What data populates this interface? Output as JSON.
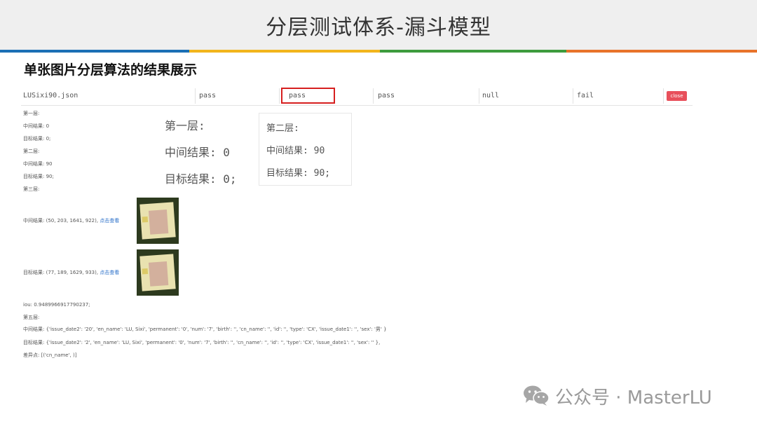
{
  "header": {
    "title": "分层测试体系-漏斗模型"
  },
  "section_title": "单张图片分层算法的结果展示",
  "result_row": {
    "file": "LUSixi90.json",
    "c1": "pass",
    "c2": "pass",
    "c3": "pass",
    "c4": "null",
    "c5": "fail",
    "close_label": "close"
  },
  "small_log": {
    "l1_title": "第一层:",
    "l1_mid": "中间结果: 0",
    "l1_target": "目标结果: 0;",
    "l2_title": "第二层:",
    "l2_mid": "中间结果: 90",
    "l2_target": "目标结果: 90;",
    "l3_title": "第三层:",
    "l3_mid": "中间结果: (50, 203, 1641, 922),",
    "l3_target": "目标结果: (77, 189, 1629, 933),",
    "view_link": "点击查看",
    "iou": "iou: 0.9489966917790237;",
    "l5_title": "第五层:",
    "l5_mid": "中间结果: {'issue_date2': '20',  'en_name': 'LU, Sixi',  'permanent': '0',  'num': '7',  'birth': '',  'cn_name': '',  'id': '',  'type': 'CX',  'issue_date1': '',  'sex': '男' }",
    "l5_target": "目标结果: {'issue_date2': '2',  'en_name': 'LU, Sixi',  'permanent': '0',  'num': '7',  'birth': '',  'cn_name': '',  'id': '',  'type': 'CX',  'issue_date1': '',  'sex': '' },",
    "diff": "差异点: [('cn_name',                 )]"
  },
  "zoom_layer1": {
    "title": "第一层:",
    "mid": "中间结果: 0",
    "target": "目标结果: 0;"
  },
  "zoom_layer2": {
    "title": "第二层:",
    "mid": "中间结果: 90",
    "target": "目标结果: 90;"
  },
  "footer": {
    "text": "公众号 · MasterLU",
    "icon": "wechat-icon"
  },
  "colors": {
    "stripe": [
      "#1b6fb5",
      "#f2b51c",
      "#3d9b3d",
      "#e8732a"
    ],
    "highlight": "#d61f1f",
    "close": "#e8505b",
    "link": "#2a6fc9"
  }
}
